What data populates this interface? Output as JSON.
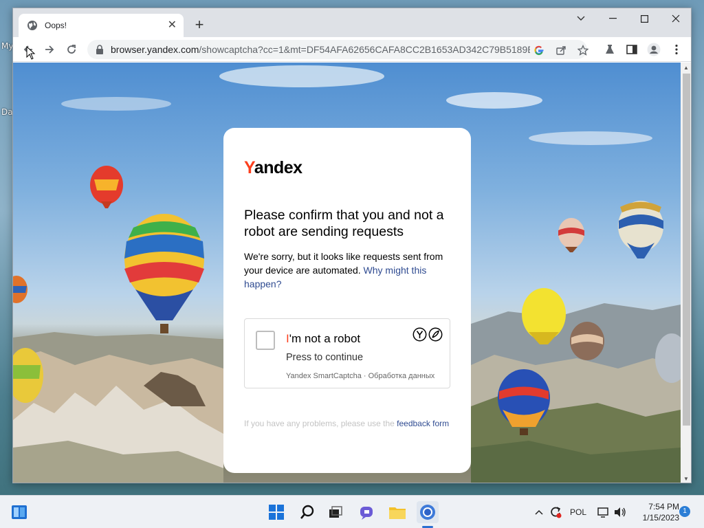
{
  "desktop": {
    "label_1": "My",
    "label_2": "Da"
  },
  "browser": {
    "tab_title": "Oops!",
    "url_host": "browser.yandex.com",
    "url_rest": "/showcaptcha?cc=1&mt=DF54AFA62656CAFA8CC2B1653AD342C79B5189E..."
  },
  "captcha": {
    "logo_first": "Y",
    "logo_rest": "andex",
    "heading": "Please confirm that you and not a robot are sending requests",
    "description": "We're sorry, but it looks like requests sent from your device are automated. ",
    "why_link": "Why might this happen?",
    "checkbox_label_accent": "I",
    "checkbox_label_rest": "'m not a robot",
    "checkbox_sub": "Press to continue",
    "brand_line": "Yandex SmartCaptcha · Обработка данных",
    "footer_text": "If you have any problems, please use the ",
    "footer_link": "feedback form",
    "accent_color": "#fc3f1d",
    "link_color": "#2f4b91"
  },
  "taskbar": {
    "language": "POL",
    "time": "7:54 PM",
    "date": "1/15/2023",
    "notification_count": "1"
  }
}
